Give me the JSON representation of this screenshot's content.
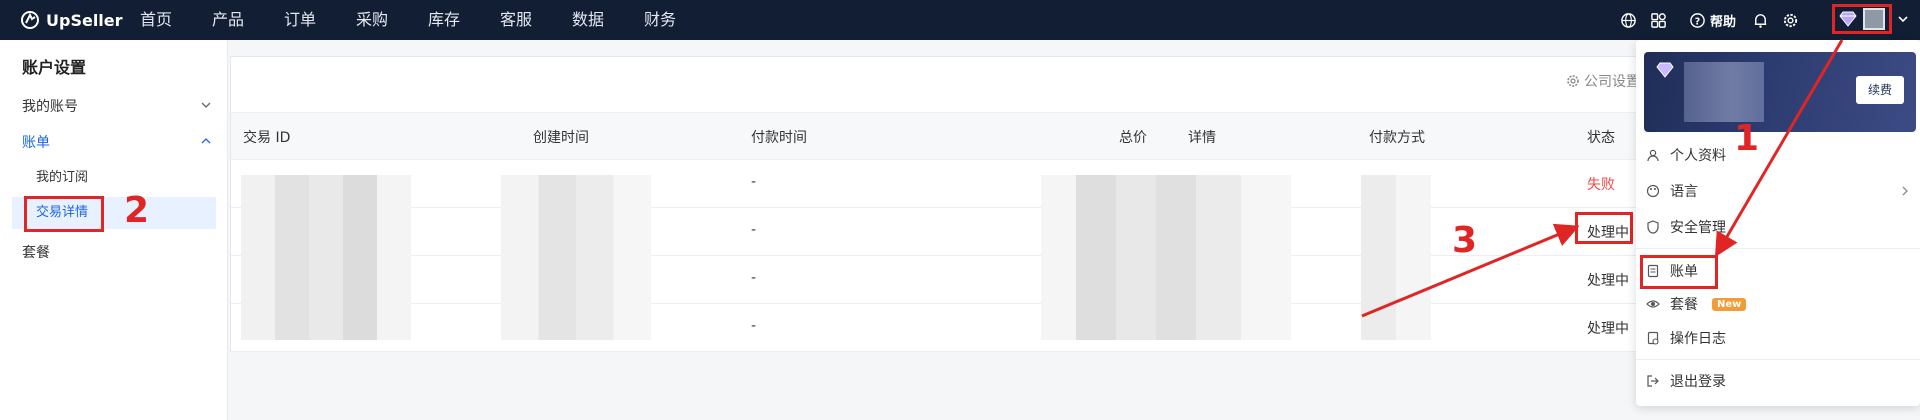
{
  "brand": "UpSeller",
  "nav": [
    "首页",
    "产品",
    "订单",
    "采购",
    "库存",
    "客服",
    "数据",
    "财务"
  ],
  "header": {
    "help_label": "帮助"
  },
  "sidebar": {
    "title": "账户设置",
    "items": [
      {
        "label": "我的账号"
      },
      {
        "label": "账单"
      },
      {
        "label": "套餐"
      }
    ],
    "subitems": [
      "我的订阅",
      "交易详情"
    ]
  },
  "main": {
    "company_settings": "公司设置",
    "columns": [
      "交易 ID",
      "创建时间",
      "付款时间",
      "总价",
      "详情",
      "付款方式",
      "状态"
    ],
    "rows": [
      {
        "pay_time": "-",
        "status": "失败"
      },
      {
        "pay_time": "-",
        "status": "处理中"
      },
      {
        "pay_time": "-",
        "status": "处理中"
      },
      {
        "pay_time": "-",
        "status": "处理中"
      }
    ]
  },
  "dropdown": {
    "renew_label": "续费",
    "items": [
      "个人资料",
      "语言",
      "安全管理",
      "账单",
      "套餐",
      "操作日志",
      "退出登录"
    ],
    "new_badge": "New"
  },
  "annotations": [
    "1",
    "2",
    "3"
  ],
  "colors": {
    "topbar": "#111e33",
    "accent": "#1a66e8",
    "fail": "#f04848",
    "annotation": "#e02525",
    "badge": "#f39b34"
  }
}
